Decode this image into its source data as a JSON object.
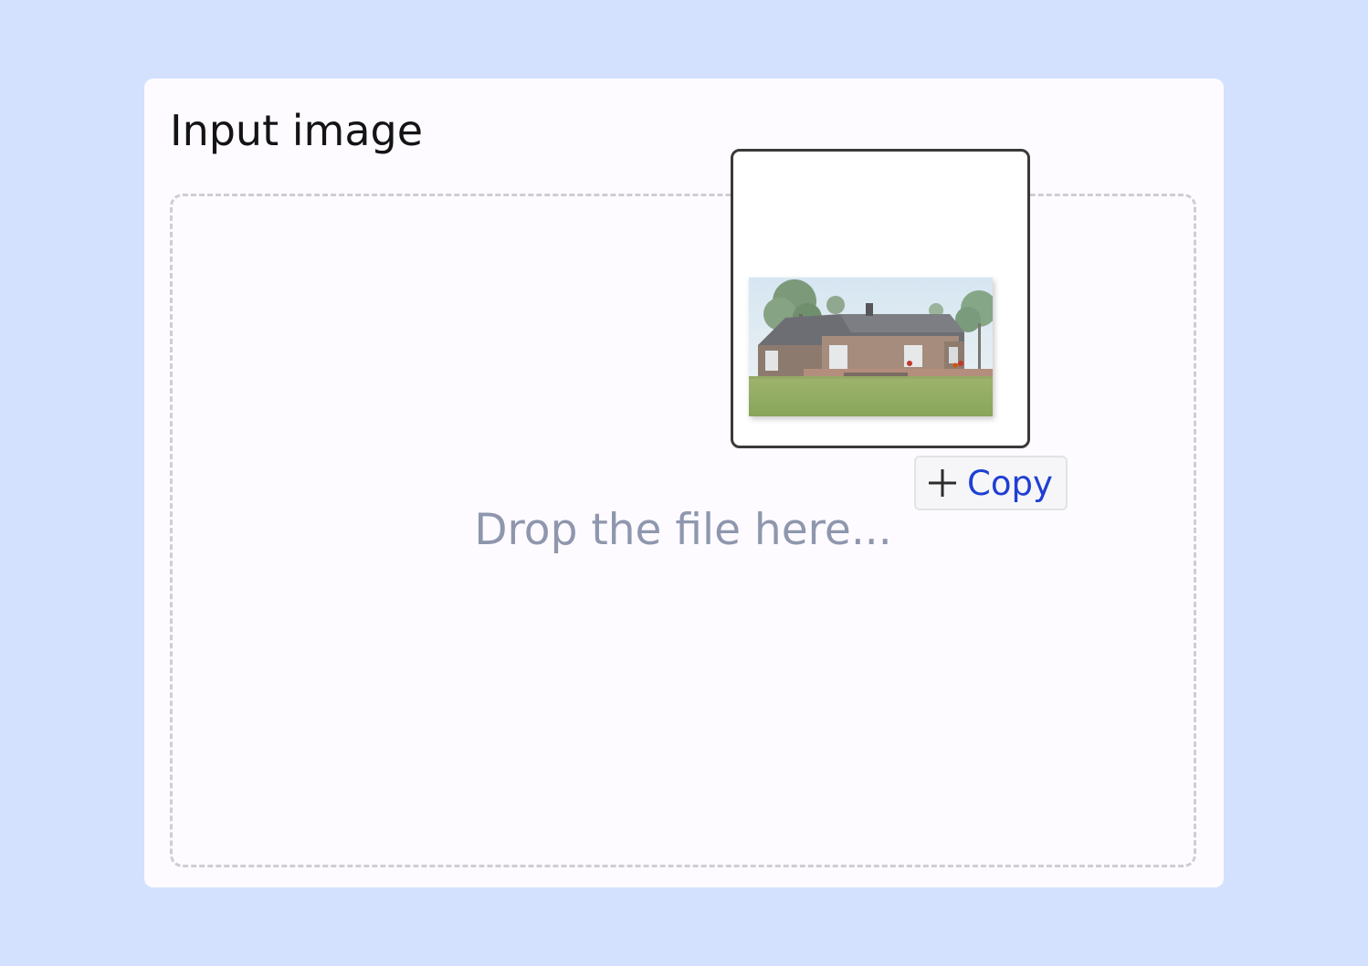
{
  "panel": {
    "title": "Input image"
  },
  "dropzone": {
    "prompt": "Drop the file here..."
  },
  "drag": {
    "preview_icon": "image-file-icon",
    "thumbnail_subject": "house-rendering",
    "copy_icon": "plus-icon",
    "copy_label": "Copy"
  },
  "colors": {
    "page_background": "#d3e1ff",
    "card_background": "#fdfbff",
    "prompt_text": "#8e97ad",
    "copy_text": "#1f3fd4"
  }
}
